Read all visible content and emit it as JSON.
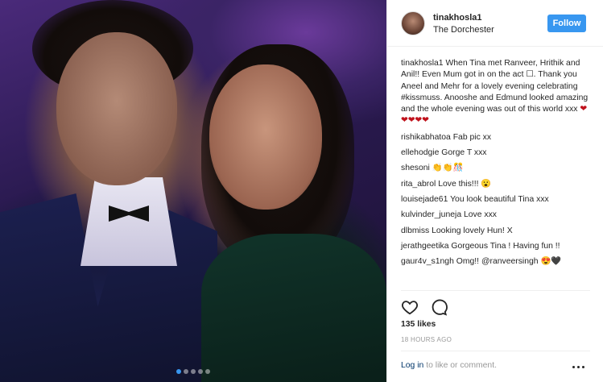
{
  "post": {
    "carousel": {
      "count": 5,
      "active_index": 0
    }
  },
  "header": {
    "username": "tinakhosla1",
    "location": "The Dorchester",
    "follow_label": "Follow"
  },
  "caption": {
    "username": "tinakhosla1",
    "text": "When Tina met Ranveer, Hrithik and Anil!! Even Mum got in on the act ☐. Thank you Aneel and Mehr for a lovely evening celebrating #kissmuss. Anooshe and Edmund looked amazing and the whole evening was out of this world xxx",
    "hearts": "❤❤❤❤❤"
  },
  "comments": [
    {
      "username": "rishikabhatoa",
      "text": "Fab pic xx",
      "emoji": ""
    },
    {
      "username": "ellehodgie",
      "text": "Gorge T xxx",
      "emoji": ""
    },
    {
      "username": "shesoni",
      "text": "",
      "emoji": "👏👏🎊"
    },
    {
      "username": "rita_abrol",
      "text": "Love this!!!",
      "emoji": "😮"
    },
    {
      "username": "louisejade61",
      "text": "You look beautiful Tina xxx",
      "emoji": ""
    },
    {
      "username": "kulvinder_juneja",
      "text": "Love xxx",
      "emoji": ""
    },
    {
      "username": "dlbmiss",
      "text": "Looking lovely Hun! X",
      "emoji": ""
    },
    {
      "username": "jerathgeetika",
      "text": "Gorgeous Tina ! Having fun !!",
      "emoji": ""
    },
    {
      "username": "gaur4v_s1ngh",
      "text": "Omg!! @ranveersingh",
      "emoji": "😍🖤"
    }
  ],
  "actions": {
    "like_icon": "heart-outline-icon",
    "comment_icon": "comment-bubble-icon"
  },
  "likes": "135 likes",
  "timestamp": "18 HOURS AGO",
  "footer": {
    "login_link": "Log in",
    "login_rest": "to like or comment.",
    "more_icon": "more-options-icon"
  }
}
